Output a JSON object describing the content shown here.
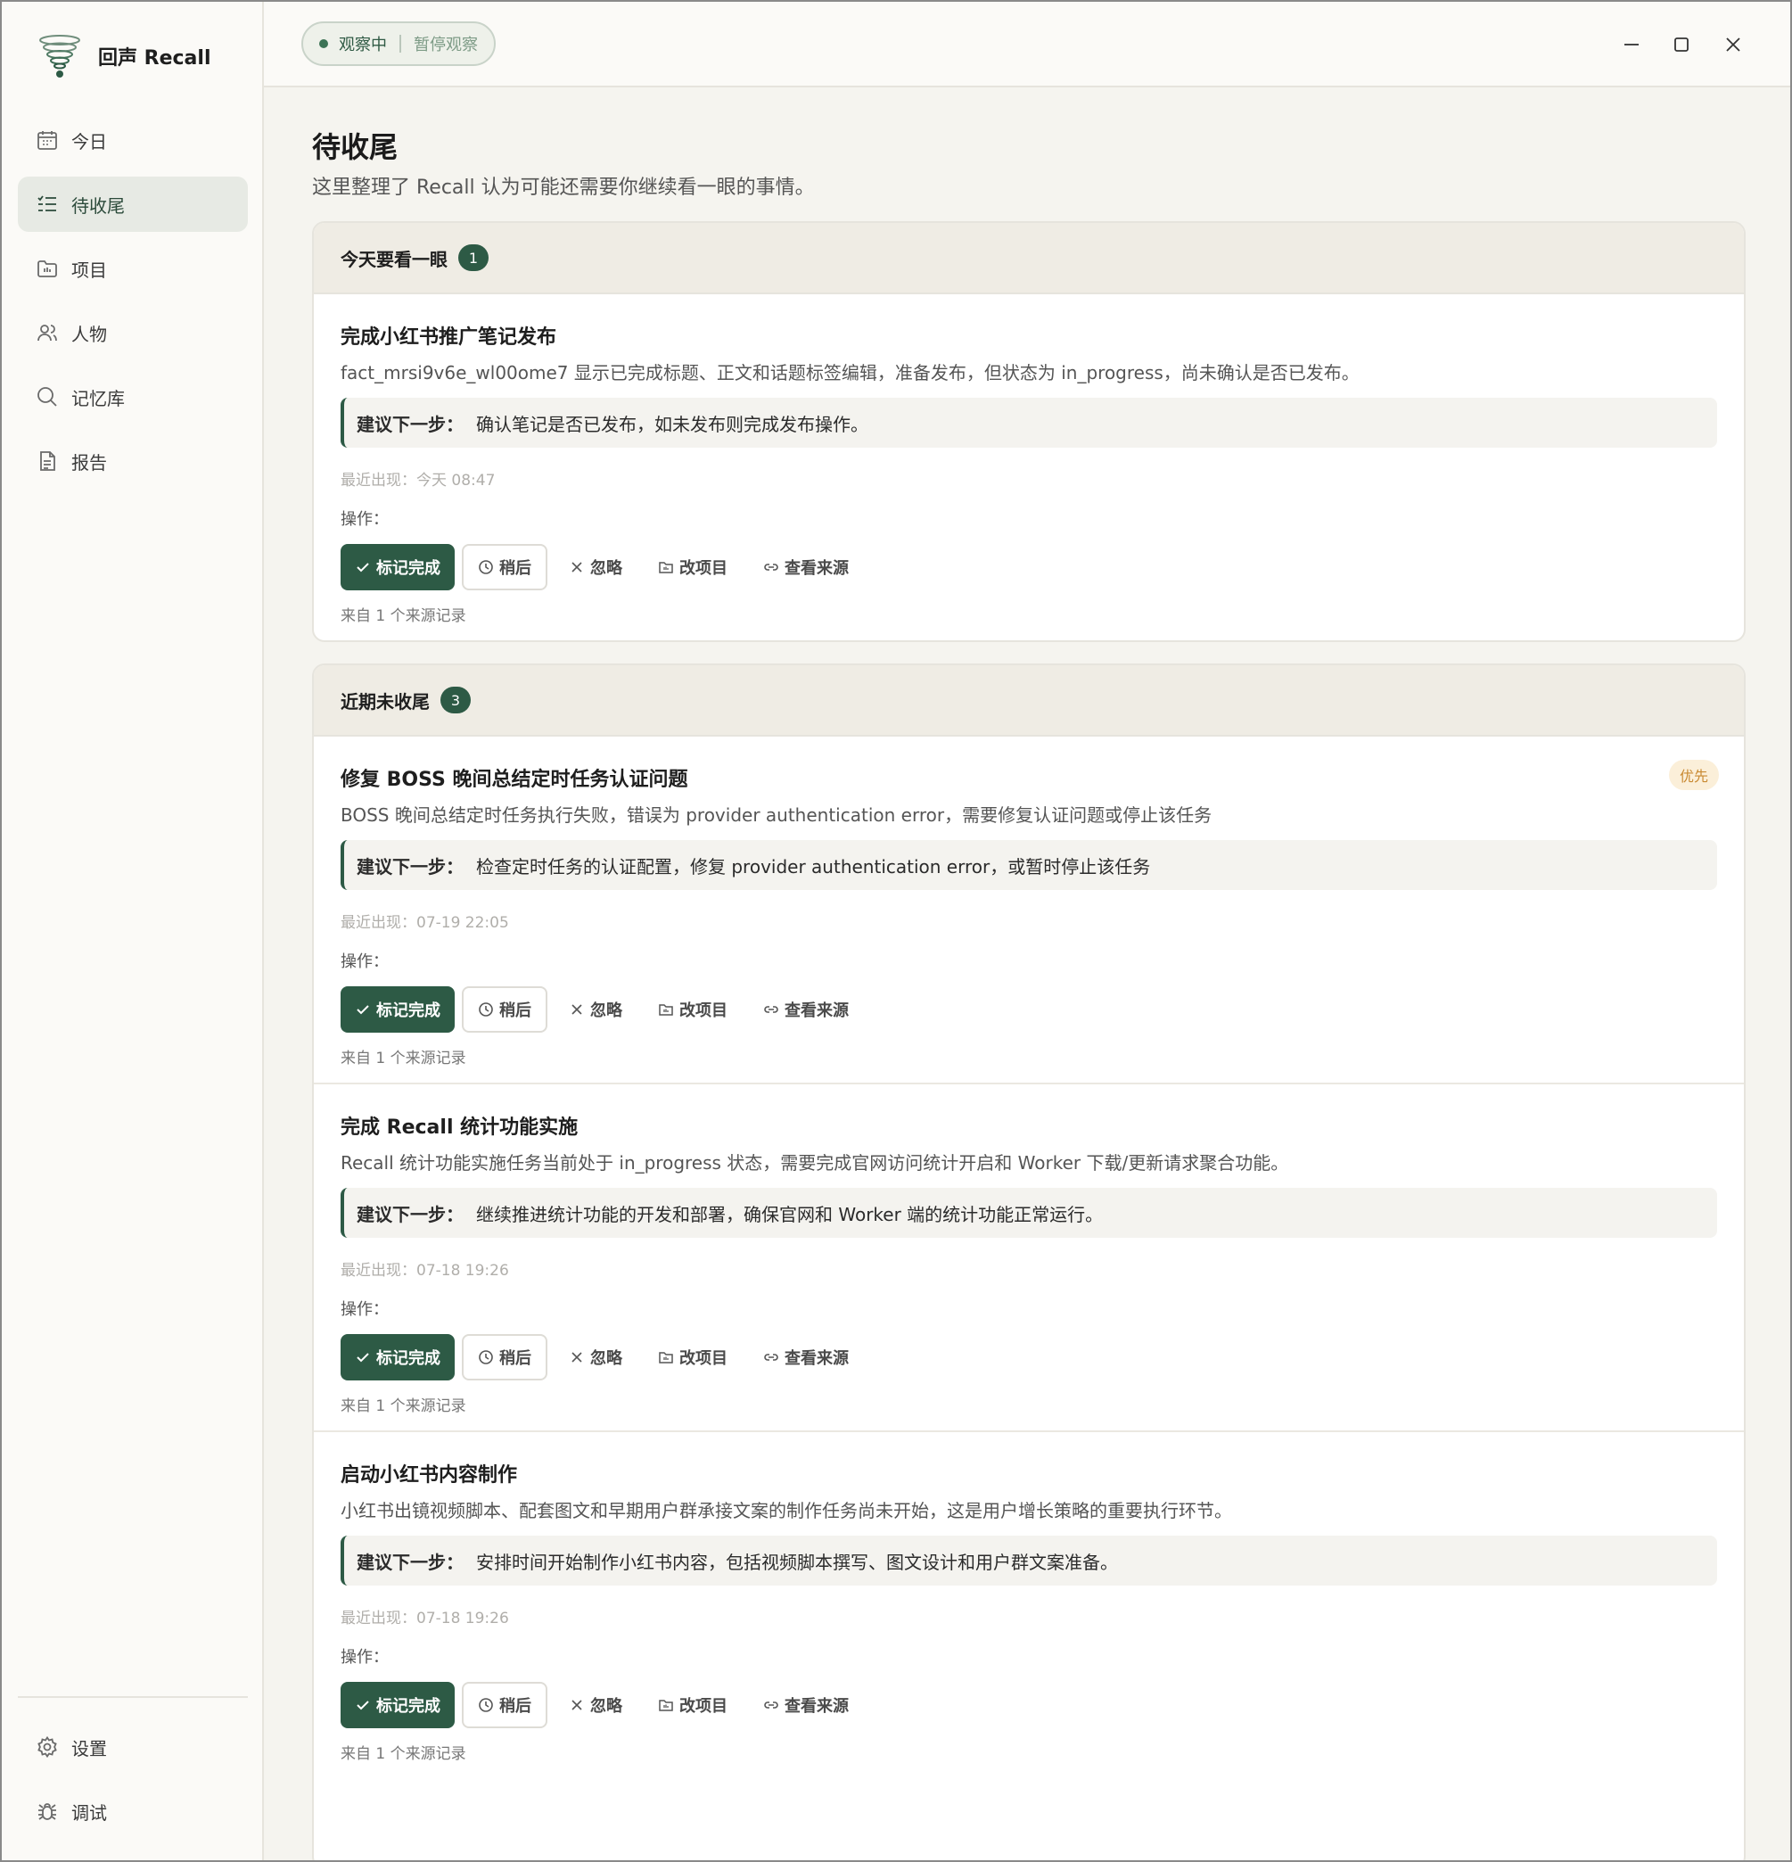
{
  "app": {
    "name": "回声 Recall"
  },
  "topbar": {
    "status_active": "观察中",
    "status_pause": "暂停观察"
  },
  "sidebar": {
    "items": [
      {
        "label": "今日",
        "icon": "calendar-icon"
      },
      {
        "label": "待收尾",
        "icon": "list-check-icon",
        "active": true
      },
      {
        "label": "项目",
        "icon": "folder-icon"
      },
      {
        "label": "人物",
        "icon": "people-icon"
      },
      {
        "label": "记忆库",
        "icon": "search-icon"
      },
      {
        "label": "报告",
        "icon": "document-icon"
      }
    ],
    "bottom": [
      {
        "label": "设置",
        "icon": "gear-icon"
      },
      {
        "label": "调试",
        "icon": "bug-icon"
      }
    ]
  },
  "page": {
    "title": "待收尾",
    "description": "这里整理了 Recall 认为可能还需要你继续看一眼的事情。"
  },
  "labels": {
    "suggest": "建议下一步：",
    "operations": "操作：",
    "mark_done": "标记完成",
    "later": "稍后",
    "ignore": "忽略",
    "change_project": "改项目",
    "view_source": "查看来源"
  },
  "sections": [
    {
      "title": "今天要看一眼",
      "count": "1",
      "items": [
        {
          "title": "完成小红书推广笔记发布",
          "desc": "fact_mrsi9v6e_wl00ome7 显示已完成标题、正文和话题标签编辑，准备发布，但状态为 in_progress，尚未确认是否已发布。",
          "suggest": "确认笔记是否已发布，如未发布则完成发布操作。",
          "recent": "最近出现：今天 08:47",
          "source": "来自 1 个来源记录"
        }
      ]
    },
    {
      "title": "近期未收尾",
      "count": "3",
      "items": [
        {
          "title": "修复 BOSS 晚间总结定时任务认证问题",
          "priority": "优先",
          "desc": "BOSS 晚间总结定时任务执行失败，错误为 provider authentication error，需要修复认证问题或停止该任务",
          "suggest": "检查定时任务的认证配置，修复 provider authentication error，或暂时停止该任务",
          "recent": "最近出现：07-19 22:05",
          "source": "来自 1 个来源记录"
        },
        {
          "title": "完成 Recall 统计功能实施",
          "desc": "Recall 统计功能实施任务当前处于 in_progress 状态，需要完成官网访问统计开启和 Worker 下载/更新请求聚合功能。",
          "suggest": "继续推进统计功能的开发和部署，确保官网和 Worker 端的统计功能正常运行。",
          "recent": "最近出现：07-18 19:26",
          "source": "来自 1 个来源记录"
        },
        {
          "title": "启动小红书内容制作",
          "desc": "小红书出镜视频脚本、配套图文和早期用户群承接文案的制作任务尚未开始，这是用户增长策略的重要执行环节。",
          "suggest": "安排时间开始制作小红书内容，包括视频脚本撰写、图文设计和用户群文案准备。",
          "recent": "最近出现：07-18 19:26",
          "source": "来自 1 个来源记录"
        }
      ]
    }
  ]
}
